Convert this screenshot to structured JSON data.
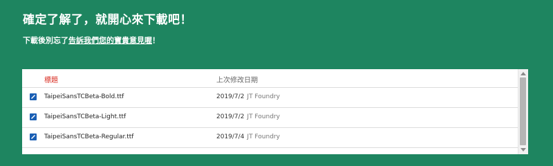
{
  "heading": "確定了解了，就開心來下載吧！",
  "notice": {
    "prefix": "下載後別忘了",
    "link": "告訴我們您的寶貴意見喔",
    "suffix": "！"
  },
  "file_list": {
    "columns": {
      "title": "標題",
      "modified": "上次修改日期"
    },
    "rows": [
      {
        "icon": "document-icon",
        "name": "TaipeiSansTCBeta-Bold.ttf",
        "date": "2019/7/2",
        "owner": "JT Foundry"
      },
      {
        "icon": "document-icon",
        "name": "TaipeiSansTCBeta-Light.ttf",
        "date": "2019/7/2",
        "owner": "JT Foundry"
      },
      {
        "icon": "document-icon",
        "name": "TaipeiSansTCBeta-Regular.ttf",
        "date": "2019/7/4",
        "owner": "JT Foundry"
      }
    ]
  },
  "colors": {
    "background": "#1e8560",
    "title_column": "#d93025",
    "file_icon": "#1a5fb4"
  }
}
